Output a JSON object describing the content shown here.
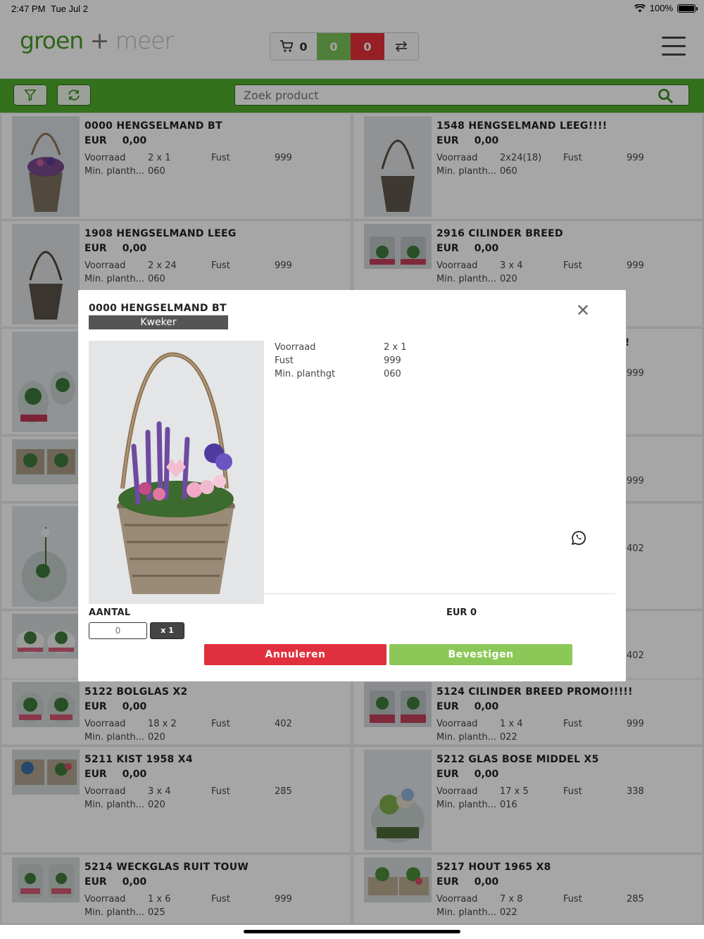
{
  "status_bar": {
    "time": "2:47 PM",
    "date": "Tue Jul 2",
    "battery": "100%"
  },
  "header": {
    "logo_main": "groen",
    "logo_plus": "+",
    "logo_sub": "meer",
    "cart_count": "0",
    "green_count": "0",
    "red_count": "0"
  },
  "toolbar": {
    "search_placeholder": "Zoek product"
  },
  "products": [
    {
      "name": "0000 HENGSELMAND BT",
      "currency": "EUR",
      "price": "0,00",
      "voorraad_label": "Voorraad",
      "voorraad": "2 x 1",
      "fust_label": "Fust",
      "fust": "999",
      "min_label": "Min. planth...",
      "min": "060"
    },
    {
      "name": "1548 HENGSELMAND LEEG!!!!",
      "currency": "EUR",
      "price": "0,00",
      "voorraad_label": "Voorraad",
      "voorraad": "2x24(18)",
      "fust_label": "Fust",
      "fust": "999",
      "min_label": "Min. planth...",
      "min": "060"
    },
    {
      "name": "1908 HENGSELMAND LEEG",
      "currency": "EUR",
      "price": "0,00",
      "voorraad_label": "Voorraad",
      "voorraad": "2 x 24",
      "fust_label": "Fust",
      "fust": "999",
      "min_label": "Min. planth...",
      "min": "060"
    },
    {
      "name": "2916 CILINDER BREED",
      "currency": "EUR",
      "price": "0,00",
      "voorraad_label": "Voorraad",
      "voorraad": "3 x 4",
      "fust_label": "Fust",
      "fust": "999",
      "min_label": "Min. planth...",
      "min": "020"
    },
    {
      "name": "5122 BOLGLAS X2",
      "currency": "EUR",
      "price": "0,00",
      "voorraad_label": "Voorraad",
      "voorraad": "18 x 2",
      "fust_label": "Fust",
      "fust": "402",
      "min_label": "Min. planth...",
      "min": "020"
    },
    {
      "name": "5124 CILINDER BREED PROMO!!!!!",
      "currency": "EUR",
      "price": "0,00",
      "voorraad_label": "Voorraad",
      "voorraad": "1 x 4",
      "fust_label": "Fust",
      "fust": "999",
      "min_label": "Min. planth...",
      "min": "022"
    },
    {
      "name": "5211 KIST 1958 X4",
      "currency": "EUR",
      "price": "0,00",
      "voorraad_label": "Voorraad",
      "voorraad": "3 x 4",
      "fust_label": "Fust",
      "fust": "285",
      "min_label": "Min. planth...",
      "min": "020"
    },
    {
      "name": "5212 GLAS BOSE MIDDEL X5",
      "currency": "EUR",
      "price": "0,00",
      "voorraad_label": "Voorraad",
      "voorraad": "17 x 5",
      "fust_label": "Fust",
      "fust": "338",
      "min_label": "Min. planth...",
      "min": "016"
    },
    {
      "name": "5214 WECKGLAS RUIT TOUW",
      "currency": "EUR",
      "price": "0,00",
      "voorraad_label": "Voorraad",
      "voorraad": "1 x 6",
      "fust_label": "Fust",
      "fust": "999",
      "min_label": "Min. planth...",
      "min": "025"
    },
    {
      "name": "5217 HOUT 1965 X8",
      "currency": "EUR",
      "price": "0,00",
      "voorraad_label": "Voorraad",
      "voorraad": "7 x 8",
      "fust_label": "Fust",
      "fust": "285",
      "min_label": "Min. planth...",
      "min": "022"
    }
  ],
  "hidden_fragments": {
    "excl": "!",
    "f1": "999",
    "f2": "999",
    "f3": "402",
    "f4": "402"
  },
  "modal": {
    "title": "0000 HENGSELMAND BT",
    "badge": "Kweker",
    "close": "✕",
    "specs": [
      {
        "label": "Voorraad",
        "value": "2 x 1"
      },
      {
        "label": "Fust",
        "value": "999"
      },
      {
        "label": "Min. planthgt",
        "value": "060"
      }
    ],
    "aantal_label": "AANTAL",
    "total": "EUR 0",
    "qty_placeholder": "0",
    "multiplier": "x 1",
    "cancel": "Annuleren",
    "confirm": "Bevestigen"
  },
  "colors": {
    "brand_green": "#4fae2d",
    "danger_red": "#e0303e",
    "confirm_green": "#8cc858"
  }
}
